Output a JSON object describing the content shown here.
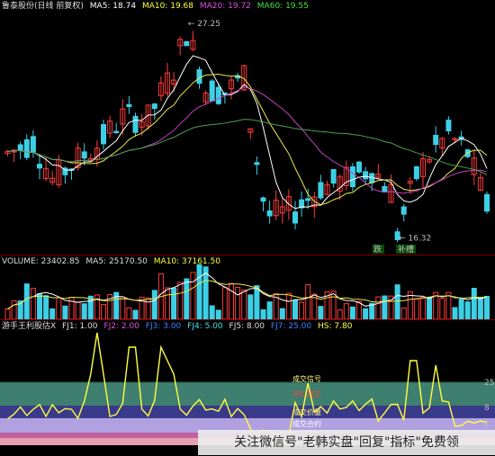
{
  "price_header": {
    "title": "鲁泰股份(日线 前复权)",
    "ma5": "MA5: 18.74",
    "ma10": "MA10: 19.68",
    "ma20": "MA20: 19.72",
    "ma60": "MA60: 19.55"
  },
  "volume_header": {
    "volume": "VOLUME: 23402.85",
    "ma5": "MA5: 25170.50",
    "ma10": "MA10: 37161.50"
  },
  "indicator_header": {
    "title": "游手王利股估X",
    "fj1": "FJ1: 1.00",
    "fj2": "FJ2: 2.00",
    "fj3": "FJ3: 3.00",
    "fj4": "FJ4: 5.00",
    "fj5": "FJ5: 8.00",
    "fj7": "FJ7: 25.00",
    "hs": "HS: 7.80"
  },
  "annotations": {
    "high": "27.25",
    "low": "16.32",
    "badge_left": "跌",
    "badge_right": "补槽"
  },
  "bands": {
    "b1": "成交信号",
    "b2": "平均成交",
    "b3": "成交价量",
    "b4": "成交合约"
  },
  "axis": {
    "t1": "25",
    "t2": "8",
    "t3": "2"
  },
  "watermark": "关注微信号\"老韩实盘\"回复\"指标\"免费领",
  "colors": {
    "up": "#ff3b3b",
    "down": "#3cd0e6",
    "ma5": "#ffffff",
    "ma10": "#e8e84a",
    "ma20": "#c040c0",
    "ma60": "#4ea04e",
    "hs_line": "#ffff40"
  }
}
